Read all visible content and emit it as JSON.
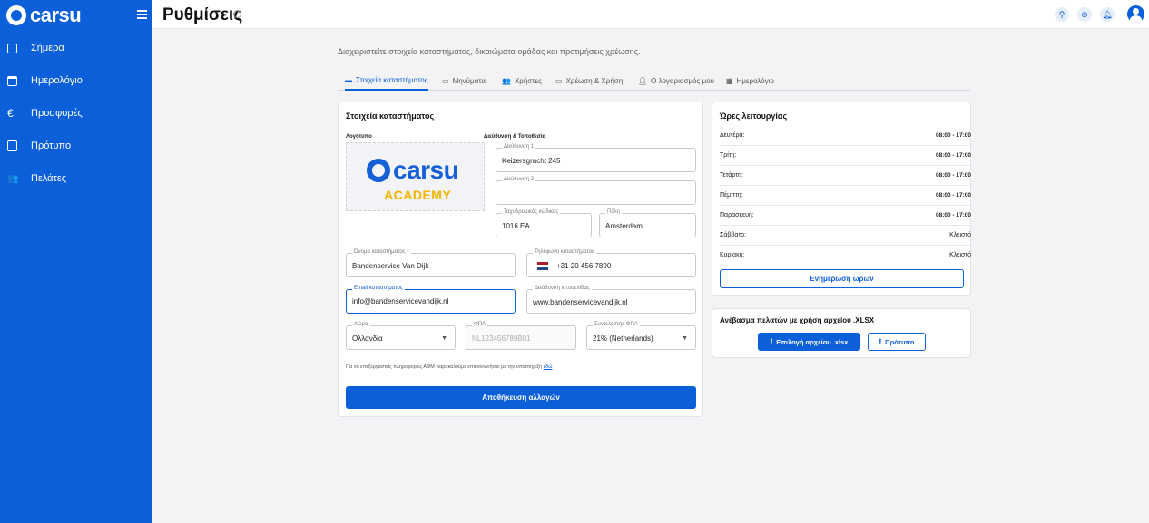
{
  "brand": {
    "name": "carsu"
  },
  "sidebar": {
    "items": [
      {
        "label": "Σήμερα",
        "icon": "calendar-today-icon"
      },
      {
        "label": "Ημερολόγιο",
        "icon": "calendar-icon"
      },
      {
        "label": "Προσφορές",
        "icon": "euro-icon"
      },
      {
        "label": "Πρότυπο",
        "icon": "clipboard-icon"
      },
      {
        "label": "Πελάτες",
        "icon": "people-icon"
      }
    ]
  },
  "header": {
    "title": "Ρυθμίσεις"
  },
  "subtitle": "Διαχειριστείτε στοιχεία καταστήματος, δικαιώματα ομάδας και προτιμήσεις χρέωσης.",
  "tabs": [
    {
      "label": "Στοιχεία καταστήματος",
      "icon": "store-icon",
      "active": true
    },
    {
      "label": "Μηνύματα",
      "icon": "message-icon",
      "active": false
    },
    {
      "label": "Χρήστες",
      "icon": "users-icon",
      "active": false
    },
    {
      "label": "Χρέωση & Χρήση",
      "icon": "credit-card-icon",
      "active": false
    },
    {
      "label": "Ο λογαριασμός μου",
      "icon": "person-icon",
      "active": false
    },
    {
      "label": "Ημερολόγιο",
      "icon": "calendar-icon",
      "active": false
    }
  ],
  "store": {
    "title": "Στοιχεία καταστήματος",
    "logo_label": "Λογότυπο",
    "logo": {
      "word": "carsu",
      "sub": "ACADEMY"
    },
    "address_label": "Διεύθυνση & Τοποθεσία",
    "address1": {
      "label": "Διεύθυνση 1",
      "value": "Keizersgracht 245"
    },
    "address2": {
      "label": "Διεύθυνση 2",
      "value": ""
    },
    "postal": {
      "label": "Ταχυδρομικός κώδικας",
      "value": "1016 EA"
    },
    "city": {
      "label": "Πόλη",
      "value": "Amsterdam"
    },
    "name": {
      "label": "Όνομα καταστήματος *",
      "value": "Bandenservice Van Dijk"
    },
    "phone": {
      "label": "Τηλέφωνο καταστήματος",
      "value": "+31 20 456 7890"
    },
    "email": {
      "label": "Email καταστήματος",
      "value": "info@bandenservicevandijk.nl"
    },
    "website": {
      "label": "Διεύθυνση ιστοσελίδας",
      "value": "www.bandenservicevandijk.nl"
    },
    "country": {
      "label": "Χώρα",
      "value": "Ολλανδία"
    },
    "vat": {
      "label": "ΦΠΑ",
      "placeholder": "NL123456789B01"
    },
    "vat_rate": {
      "label": "Συντελεστής ΦΠΑ",
      "value": "21% (Netherlands)"
    },
    "vat_note": "Για να επεξεργαστείς πληροφορίες ΑΦΜ παρακαλούμε επικοινωνήστε με την υποστήριξη",
    "vat_note_link": "εδώ",
    "save_label": "Αποθήκευση αλλαγών"
  },
  "hours": {
    "title": "Ώρες λειτουργίας",
    "rows": [
      {
        "day": "Δευτέρα:",
        "time": "08:00 - 17:00"
      },
      {
        "day": "Τρίτη:",
        "time": "08:00 - 17:00"
      },
      {
        "day": "Τετάρτη:",
        "time": "08:00 - 17:00"
      },
      {
        "day": "Πέμπτη:",
        "time": "08:00 - 17:00"
      },
      {
        "day": "Παρασκευή:",
        "time": "08:00 - 17:00"
      },
      {
        "day": "Σάββατο:",
        "time": "Κλειστό"
      },
      {
        "day": "Κυριακή:",
        "time": "Κλειστό"
      }
    ],
    "update_label": "Ενημέρωση ωρών"
  },
  "upload": {
    "title": "Ανέβασμα πελατών με χρήση αρχείου .XLSX",
    "choose_label": "Επιλογή αρχείου .xlsx",
    "template_label": "Πρότυπο"
  },
  "colors": {
    "primary": "#0b5fd8",
    "accent": "#f4b400"
  }
}
